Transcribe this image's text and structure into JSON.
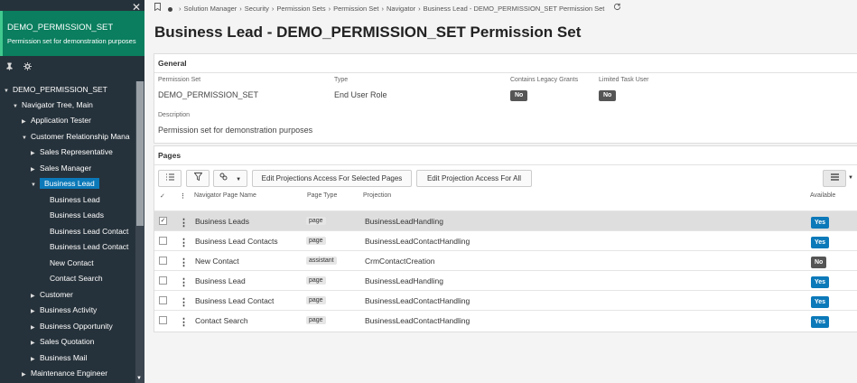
{
  "sidebar": {
    "title": "DEMO_PERMISSION_SET",
    "subtitle": "Permission set for demonstration purposes",
    "close_glyph": "✕",
    "pin_icon": "pin-icon",
    "settings_icon": "settings-icon",
    "tree": [
      {
        "label": "DEMO_PERMISSION_SET",
        "arrow": "▼"
      },
      {
        "label": "Navigator Tree, Main",
        "arrow": "▼"
      },
      {
        "label": "Application Tester",
        "arrow": "▶"
      },
      {
        "label": "Customer Relationship Mana",
        "arrow": "▼"
      },
      {
        "label": "Sales Representative",
        "arrow": "▶"
      },
      {
        "label": "Sales Manager",
        "arrow": "▶"
      },
      {
        "label": "Business Lead",
        "arrow": "▼"
      },
      {
        "label": "Business Lead",
        "arrow": ""
      },
      {
        "label": "Business Leads",
        "arrow": ""
      },
      {
        "label": "Business Lead Contact",
        "arrow": ""
      },
      {
        "label": "Business Lead Contact",
        "arrow": ""
      },
      {
        "label": "New Contact",
        "arrow": ""
      },
      {
        "label": "Contact Search",
        "arrow": ""
      },
      {
        "label": "Customer",
        "arrow": "▶"
      },
      {
        "label": "Business Activity",
        "arrow": "▶"
      },
      {
        "label": "Business Opportunity",
        "arrow": "▶"
      },
      {
        "label": "Sales Quotation",
        "arrow": "▶"
      },
      {
        "label": "Business Mail",
        "arrow": "▶"
      },
      {
        "label": "Maintenance Engineer",
        "arrow": "▶"
      }
    ]
  },
  "breadcrumb": {
    "items": [
      "Solution Manager",
      "Security",
      "Permission Sets",
      "Permission Set",
      "Navigator",
      "Business Lead - DEMO_PERMISSION_SET Permission Set"
    ],
    "separator": "›"
  },
  "page_title": "Business Lead - DEMO_PERMISSION_SET Permission Set",
  "general": {
    "heading": "General",
    "permission_set_label": "Permission Set",
    "permission_set_value": "DEMO_PERMISSION_SET",
    "type_label": "Type",
    "type_value": "End User Role",
    "legacy_label": "Contains Legacy Grants",
    "legacy_value": "No",
    "limited_label": "Limited Task User",
    "limited_value": "No",
    "description_label": "Description",
    "description_value": "Permission set for demonstration purposes"
  },
  "pages": {
    "heading": "Pages",
    "edit_selected_label": "Edit Projections Access For Selected Pages",
    "edit_all_label": "Edit Projection Access For All",
    "columns": {
      "check": "✓",
      "name": "Navigator Page Name",
      "type": "Page Type",
      "projection": "Projection",
      "available": "Available"
    },
    "rows": [
      {
        "name": "Business Leads",
        "type": "page",
        "projection": "BusinessLeadHandling",
        "available": "Yes",
        "selected": true
      },
      {
        "name": "Business Lead Contacts",
        "type": "page",
        "projection": "BusinessLeadContactHandling",
        "available": "Yes",
        "selected": false
      },
      {
        "name": "New Contact",
        "type": "assistant",
        "projection": "CrmContactCreation",
        "available": "No",
        "selected": false
      },
      {
        "name": "Business Lead",
        "type": "page",
        "projection": "BusinessLeadHandling",
        "available": "Yes",
        "selected": false
      },
      {
        "name": "Business Lead Contact",
        "type": "page",
        "projection": "BusinessLeadContactHandling",
        "available": "Yes",
        "selected": false
      },
      {
        "name": "Contact Search",
        "type": "page",
        "projection": "BusinessLeadContactHandling",
        "available": "Yes",
        "selected": false
      }
    ]
  },
  "colors": {
    "yes": "#0c79b9",
    "no": "#555555"
  }
}
